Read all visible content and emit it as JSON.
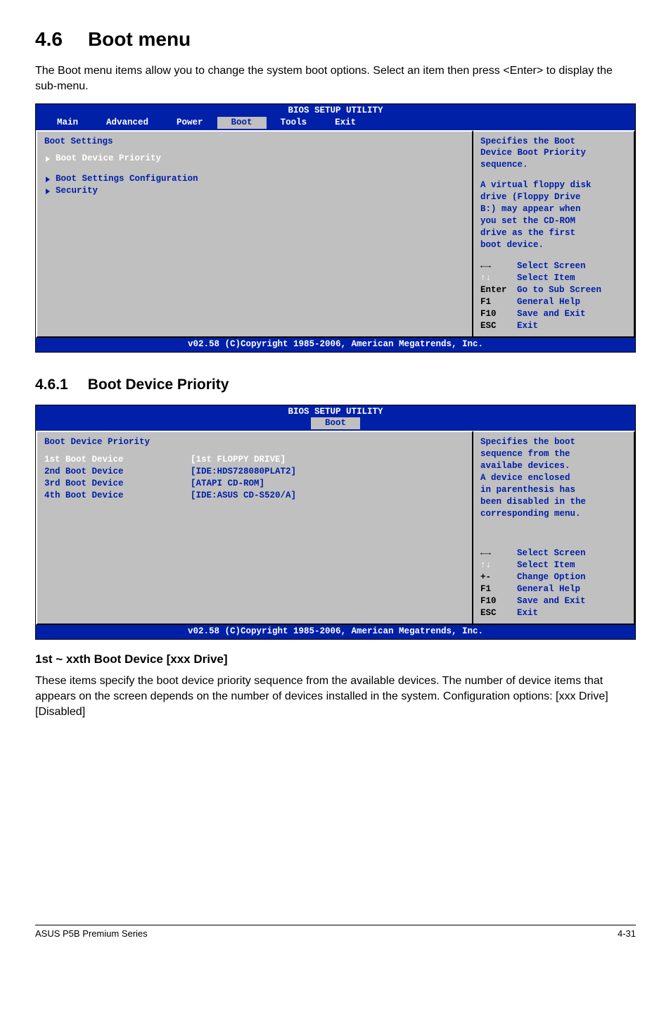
{
  "section": {
    "number": "4.6",
    "title": "Boot menu"
  },
  "intro_text": "The Boot menu items allow you to change the system boot options. Select an item then press <Enter> to display the sub-menu.",
  "bios1": {
    "header": "BIOS SETUP UTILITY",
    "tabs": [
      "Main",
      "Advanced",
      "Power",
      "Boot",
      "Tools",
      "Exit"
    ],
    "active_tab_index": 3,
    "panel_title": "Boot Settings",
    "items": [
      "Boot Device Priority",
      "Boot Settings Configuration",
      "Security"
    ],
    "help_lines": [
      "Specifies the Boot",
      "Device Boot Priority",
      "sequence."
    ],
    "help2_lines": [
      "A virtual floppy disk",
      "drive (Floppy Drive",
      "B:) may appear when",
      "you set the CD-ROM",
      "drive as the first",
      "boot device."
    ],
    "legend": {
      "arrows_lr": "←→",
      "arrows_ud": "↑↓",
      "select_screen": "Select Screen",
      "select_item": "Select Item",
      "enter_k": "Enter",
      "enter_v": "Go to Sub Screen",
      "f1_k": "F1",
      "f1_v": "General Help",
      "f10_k": "F10",
      "f10_v": "Save and Exit",
      "esc_k": "ESC",
      "esc_v": "Exit"
    },
    "footer": "v02.58 (C)Copyright 1985-2006, American Megatrends, Inc."
  },
  "subsection": {
    "number": "4.6.1",
    "title": "Boot Device Priority"
  },
  "bios2": {
    "header": "BIOS SETUP UTILITY",
    "tabs_single": "Boot",
    "panel_title": "Boot Device Priority",
    "rows": [
      {
        "label": "1st Boot Device",
        "value": "[1st FLOPPY DRIVE]",
        "selected": true
      },
      {
        "label": "2nd Boot Device",
        "value": "[IDE:HDS728080PLAT2]",
        "selected": false
      },
      {
        "label": "3rd Boot Device",
        "value": "[ATAPI CD-ROM]",
        "selected": false
      },
      {
        "label": "4th Boot Device",
        "value": "[IDE:ASUS CD-S520/A]",
        "selected": false
      }
    ],
    "help_lines": [
      "Specifies the boot",
      "sequence from the",
      "availabe devices.",
      "",
      "A device enclosed",
      "in parenthesis has",
      "been disabled in the",
      "corresponding menu."
    ],
    "legend": {
      "arrows_lr": "←→",
      "arrows_ud": "↑↓",
      "select_screen": "Select Screen",
      "select_item": "Select Item",
      "pm_k": "+-",
      "pm_v": "Change Option",
      "f1_k": "F1",
      "f1_v": "General Help",
      "f10_k": "F10",
      "f10_v": "Save and Exit",
      "esc_k": "ESC",
      "esc_v": "Exit"
    },
    "footer": "v02.58 (C)Copyright 1985-2006, American Megatrends, Inc."
  },
  "item_heading": "1st ~ xxth Boot Device [xxx Drive]",
  "item_body": "These items specify the boot device priority sequence from the available devices. The number of device items that appears on the screen depends on the number of devices installed in the system. Configuration options: [xxx Drive] [Disabled]",
  "footer": {
    "left": "ASUS P5B Premium Series",
    "right": "4-31"
  }
}
